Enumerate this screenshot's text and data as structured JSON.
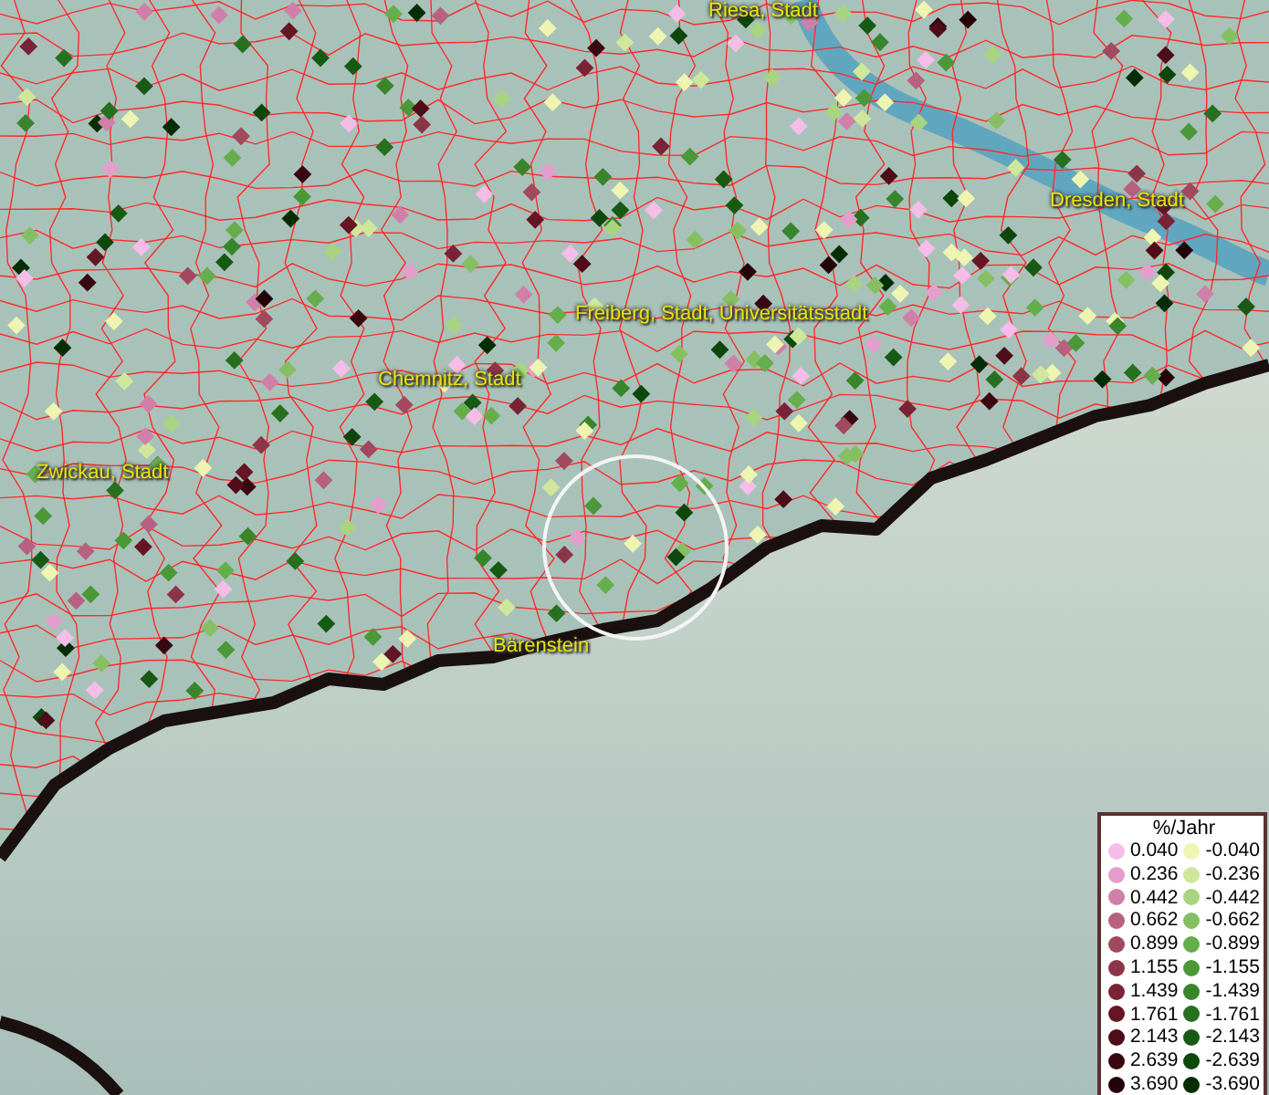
{
  "map": {
    "places": [
      {
        "name": "Riesa, Stadt"
      },
      {
        "name": "Dresden, Stadt"
      },
      {
        "name": "Freiberg, Stadt, Universitätsstadt"
      },
      {
        "name": "Chemnitz, Stadt"
      },
      {
        "name": "Zwickau, Stadt"
      },
      {
        "name": "Bärenstein"
      }
    ]
  },
  "legend": {
    "title": "%/Jahr",
    "positive": [
      {
        "label": "0.040",
        "color": "#f5bde8"
      },
      {
        "label": "0.236",
        "color": "#e39ecb"
      },
      {
        "label": "0.442",
        "color": "#d07fa8"
      },
      {
        "label": "0.662",
        "color": "#b8607f"
      },
      {
        "label": "0.899",
        "color": "#a2495f"
      },
      {
        "label": "1.155",
        "color": "#8d3548"
      },
      {
        "label": "1.439",
        "color": "#7a2336"
      },
      {
        "label": "1.761",
        "color": "#661525"
      },
      {
        "label": "2.143",
        "color": "#4e0c18"
      },
      {
        "label": "2.639",
        "color": "#380710"
      },
      {
        "label": "3.690",
        "color": "#230308"
      }
    ],
    "negative": [
      {
        "label": "-0.040",
        "color": "#eef5b0"
      },
      {
        "label": "-0.236",
        "color": "#cfe79a"
      },
      {
        "label": "-0.442",
        "color": "#a8d37f"
      },
      {
        "label": "-0.662",
        "color": "#85bf62"
      },
      {
        "label": "-0.899",
        "color": "#66ad4b"
      },
      {
        "label": "-1.155",
        "color": "#4a9838"
      },
      {
        "label": "-1.439",
        "color": "#38852b"
      },
      {
        "label": "-1.761",
        "color": "#26701f"
      },
      {
        "label": "-2.143",
        "color": "#175a14"
      },
      {
        "label": "-2.639",
        "color": "#0d470c"
      },
      {
        "label": "-3.690",
        "color": "#052d05"
      }
    ]
  }
}
